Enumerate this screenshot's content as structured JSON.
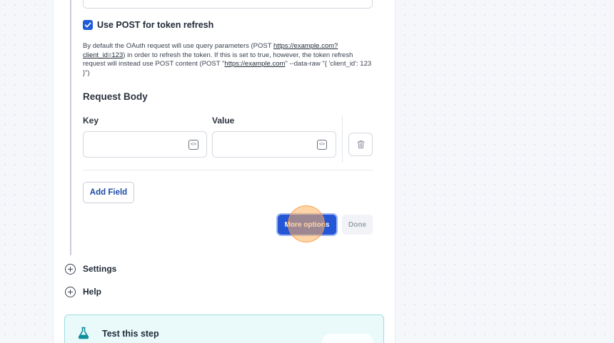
{
  "options": {
    "use_post_checkbox_label": "Use POST for token refresh",
    "use_post_checked": true,
    "description_parts": {
      "p1": "By default the OAuth request will use query parameters (POST ",
      "link1": "https://example.com?client_id=123",
      "p2": ") in order to refresh the token. If this is set to true, however, the token refresh request will instead use POST content (POST \"",
      "link2": "https://example.com",
      "p3": "\" --data-raw \"{ 'client_id': 123 }\")"
    }
  },
  "request_body": {
    "title": "Request Body",
    "key_label": "Key",
    "value_label": "Value",
    "key_value": "",
    "value_value": "",
    "add_field_label": "Add Field"
  },
  "actions": {
    "more_options_label": "More options",
    "done_label": "Done"
  },
  "sections": {
    "settings_label": "Settings",
    "help_label": "Help"
  },
  "test_card": {
    "title": "Test this step"
  },
  "colors": {
    "primary": "#2456d6",
    "checkbox": "#1e5bd8",
    "test_card_bg": "#eafafa",
    "test_card_border": "#9fdde0",
    "flask": "#0d8f9a"
  },
  "icons": {
    "checkbox": "check-icon",
    "key_field": "code-icon",
    "value_field": "code-icon",
    "delete": "trash-icon",
    "settings": "plus-circle-icon",
    "help": "plus-circle-icon",
    "test": "flask-icon"
  }
}
